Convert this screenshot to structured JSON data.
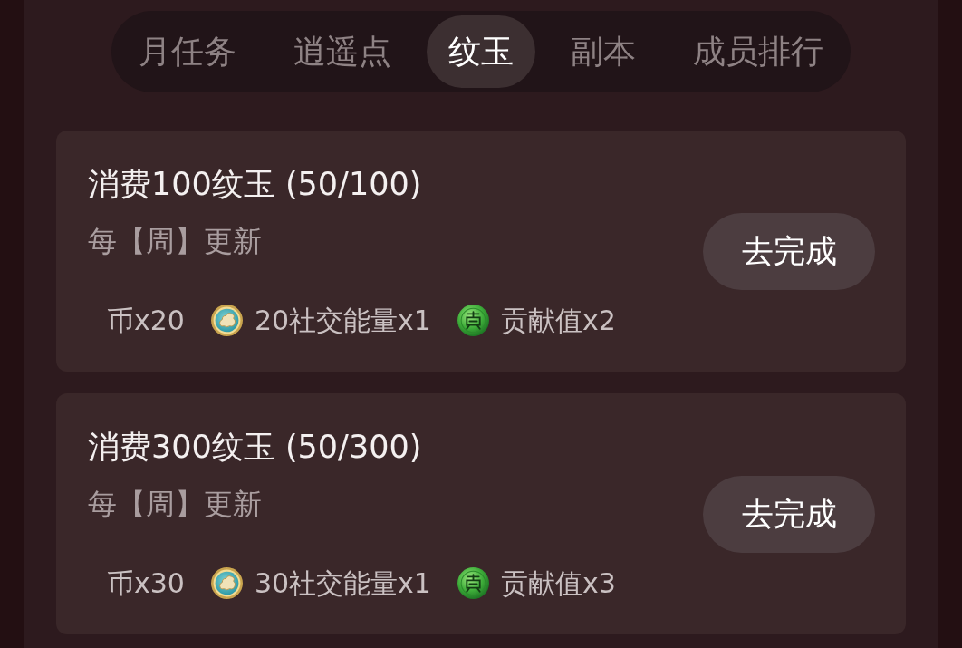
{
  "tabs": [
    {
      "label": "月任务",
      "selected": false
    },
    {
      "label": "逍遥点",
      "selected": false
    },
    {
      "label": "纹玉",
      "selected": true
    },
    {
      "label": "副本",
      "selected": false
    },
    {
      "label": "成员排行",
      "selected": false
    }
  ],
  "tasks": [
    {
      "title": "消费100纹玉 (50/100)",
      "refresh": "每【周】更新",
      "rewards": [
        {
          "kind": "plain",
          "label": "币x20"
        },
        {
          "kind": "energy",
          "label": "20社交能量x1"
        },
        {
          "kind": "jade",
          "label": "贡献值x2"
        }
      ],
      "button": "去完成"
    },
    {
      "title": "消费300纹玉 (50/300)",
      "refresh": "每【周】更新",
      "rewards": [
        {
          "kind": "plain",
          "label": "币x30"
        },
        {
          "kind": "energy",
          "label": "30社交能量x1"
        },
        {
          "kind": "jade",
          "label": "贡献值x3"
        }
      ],
      "button": "去完成"
    }
  ]
}
